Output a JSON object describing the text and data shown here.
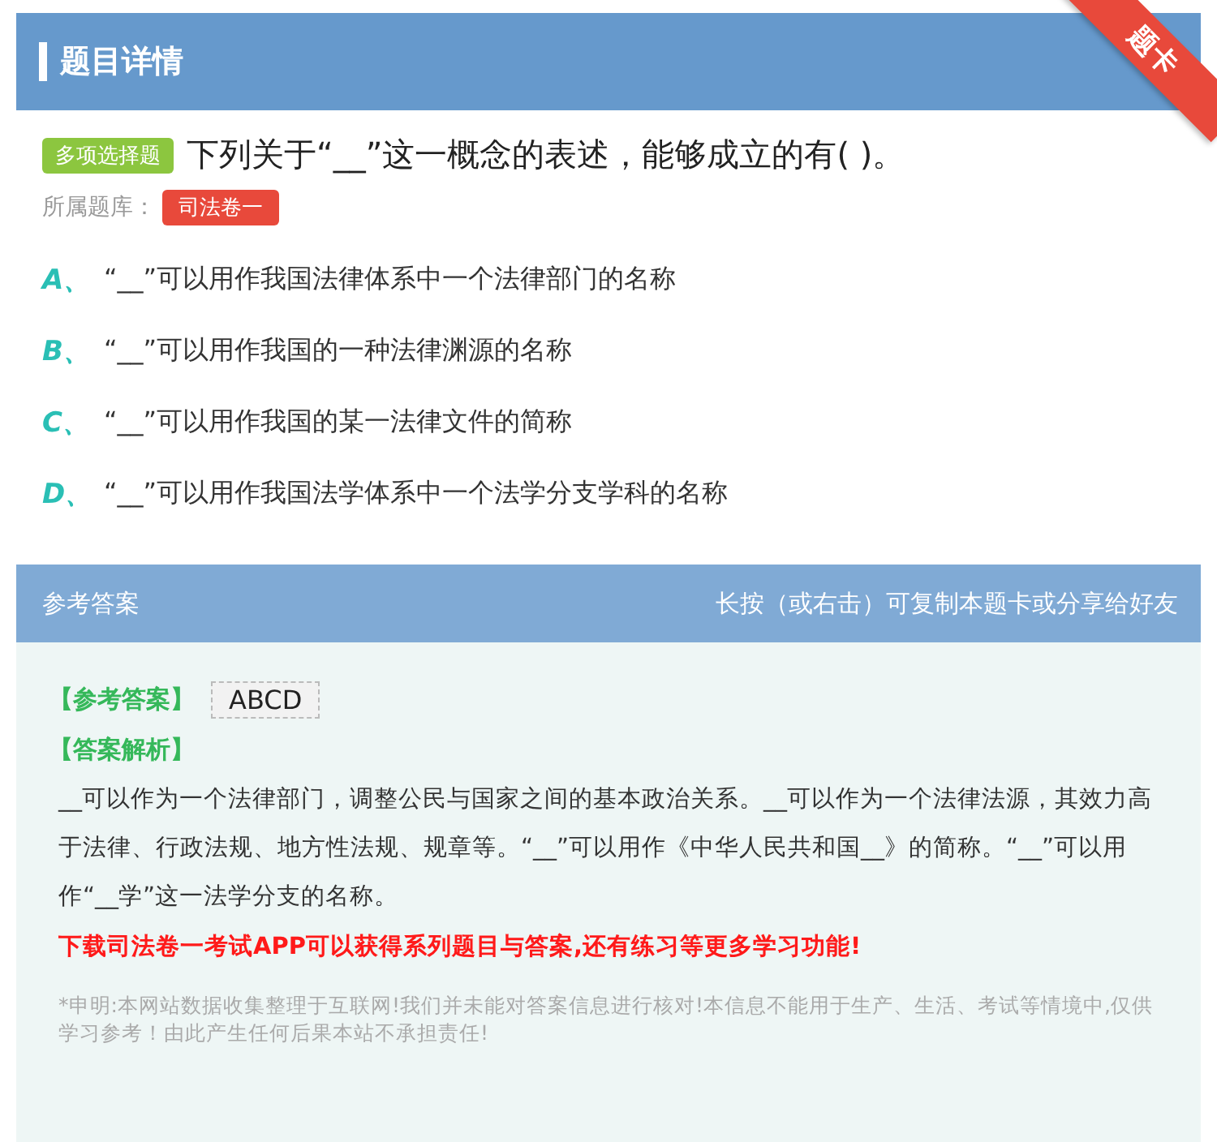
{
  "header": {
    "title": "题目详情",
    "ribbon": "题卡"
  },
  "question": {
    "type_tag": "多项选择题",
    "text": "下列关于“__”这一概念的表述，能够成立的有( )。",
    "bank_label": "所属题库：",
    "bank": "司法卷一"
  },
  "options": [
    {
      "letter": "A、",
      "text": "“__”可以用作我国法律体系中一个法律部门的名称"
    },
    {
      "letter": "B、",
      "text": "“__”可以用作我国的一种法律渊源的名称"
    },
    {
      "letter": "C、",
      "text": "“__”可以用作我国的某一法律文件的简称"
    },
    {
      "letter": "D、",
      "text": "“__”可以用作我国法学体系中一个法学分支学科的名称"
    }
  ],
  "answer_panel": {
    "title": "参考答案",
    "hint": "长按（或右击）可复制本题卡或分享给好友",
    "answer_label": "【参考答案】",
    "answer": "ABCD",
    "analysis_label": "【答案解析】",
    "analysis": "__可以作为一个法律部门，调整公民与国家之间的基本政治关系。__可以作为一个法律法源，其效力高于法律、行政法规、地方性法规、规章等。“__”可以用作《中华人民共和国__》的简称。“__”可以用作“__学”这一法学分支的名称。",
    "promo": "下载司法卷一考试APP可以获得系列题目与答案,还有练习等更多学习功能!",
    "disclaimer": "*申明:本网站数据收集整理于互联网!我们并未能对答案信息进行核对!本信息不能用于生产、生活、考试等情境中,仅供学习参考！由此产生任何后果本站不承担责任!"
  }
}
